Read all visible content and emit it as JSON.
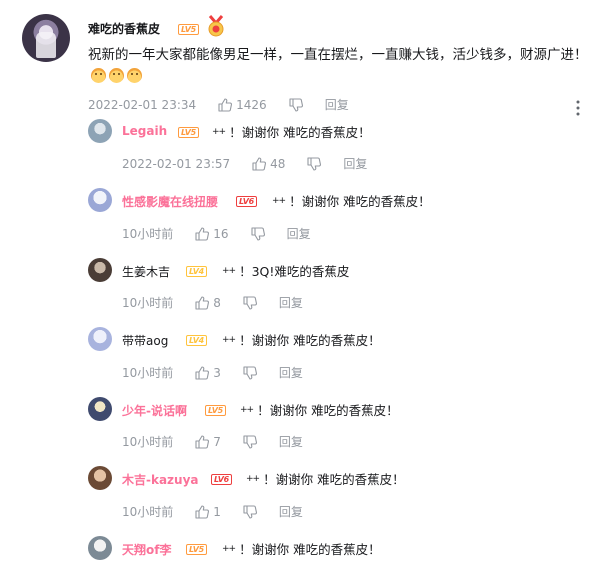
{
  "main_comment": {
    "username": "难吃的香蕉皮",
    "level": "LV5",
    "text": "祝新的一年大家都能像男足一样，一直在摆烂，一直赚大钱，活少钱多，财源广进！",
    "emojis": [
      "doge-emoji",
      "doge-emoji",
      "doge-emoji"
    ],
    "date": "2022-02-01 23:34",
    "likes": "1426",
    "reply_label": "回复"
  },
  "replies": [
    {
      "username": "Legaih",
      "name_color": "#fb7299",
      "level": "LV5",
      "level_color": "orange",
      "tag": "++",
      "text": "！谢谢你 难吃的香蕉皮！",
      "date": "2022-02-01 23:57",
      "likes": "48",
      "reply_label": "回复"
    },
    {
      "username": "性感影魔在线扭腰",
      "name_color": "#fb7299",
      "level": "LV6",
      "level_color": "red",
      "tag": "++",
      "text": "！谢谢你 难吃的香蕉皮！",
      "date": "10小时前",
      "likes": "16",
      "reply_label": "回复"
    },
    {
      "username": "生姜木吉",
      "name_color": "#18191c",
      "level": "LV4",
      "level_color": "yellow",
      "tag": "++",
      "text": "！3Q!难吃的香蕉皮",
      "date": "10小时前",
      "likes": "8",
      "reply_label": "回复"
    },
    {
      "username": "带带aog",
      "name_color": "#18191c",
      "level": "LV4",
      "level_color": "yellow",
      "tag": "++",
      "text": "！谢谢你 难吃的香蕉皮！",
      "date": "10小时前",
      "likes": "3",
      "reply_label": "回复"
    },
    {
      "username": "少年-说话啊",
      "name_color": "#fb7299",
      "level": "LV5",
      "level_color": "orange",
      "tag": "++",
      "text": "！谢谢你 难吃的香蕉皮！",
      "date": "10小时前",
      "likes": "7",
      "reply_label": "回复"
    },
    {
      "username": "木吉-kazuya",
      "name_color": "#fb7299",
      "level": "LV6",
      "level_color": "red",
      "tag": "++",
      "text": "！谢谢你 难吃的香蕉皮！",
      "date": "10小时前",
      "likes": "1",
      "reply_label": "回复"
    },
    {
      "username": "天翔of李",
      "name_color": "#fb7299",
      "level": "LV5",
      "level_color": "orange",
      "tag": "++",
      "text": "！谢谢你 难吃的香蕉皮！",
      "date": "",
      "likes": "",
      "reply_label": ""
    }
  ],
  "colors": {
    "accent_pink": "#fb7299",
    "meta_gray": "#9499a0",
    "text": "#18191c"
  }
}
